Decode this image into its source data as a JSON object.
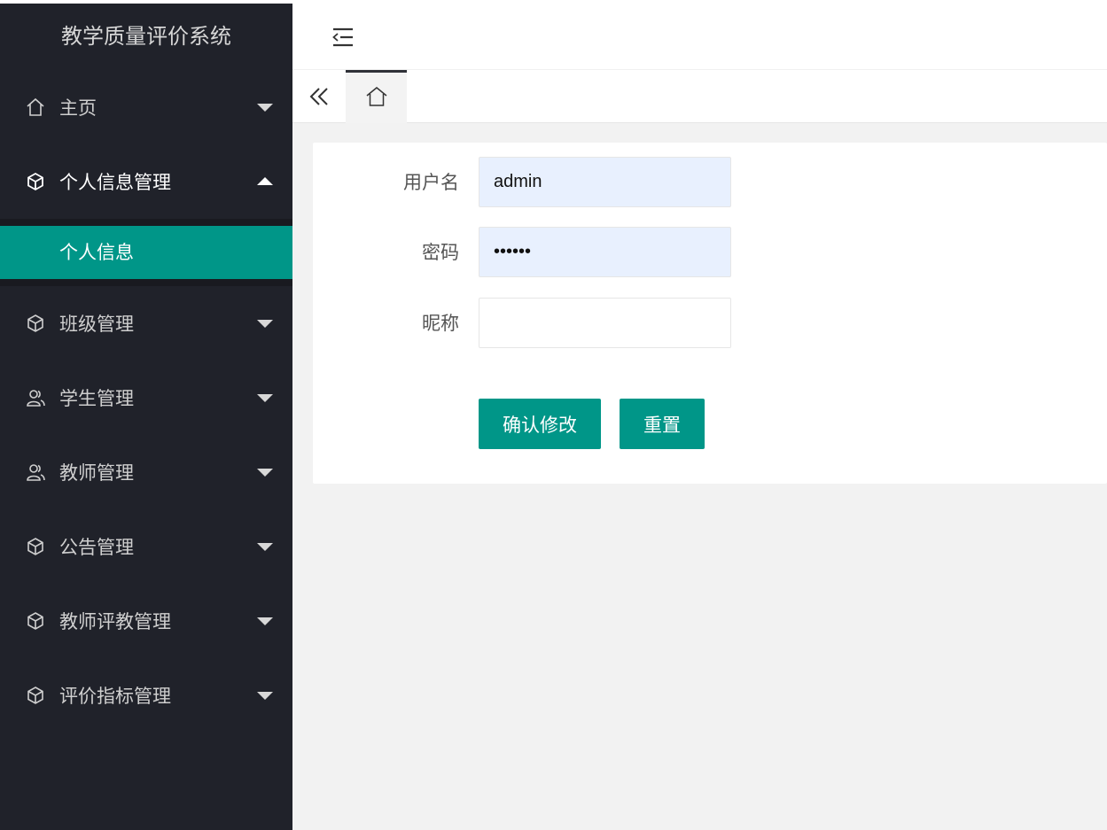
{
  "app": {
    "title": "教学质量评价系统"
  },
  "sidebar": {
    "items": [
      {
        "label": "主页",
        "icon": "home-icon",
        "state": "collapsed"
      },
      {
        "label": "个人信息管理",
        "icon": "cube-icon",
        "state": "expanded",
        "children": [
          {
            "label": "个人信息",
            "active": true
          }
        ]
      },
      {
        "label": "班级管理",
        "icon": "cube-icon",
        "state": "collapsed"
      },
      {
        "label": "学生管理",
        "icon": "users-icon",
        "state": "collapsed"
      },
      {
        "label": "教师管理",
        "icon": "users-icon",
        "state": "collapsed"
      },
      {
        "label": "公告管理",
        "icon": "cube-icon",
        "state": "collapsed"
      },
      {
        "label": "教师评教管理",
        "icon": "cube-icon",
        "state": "collapsed"
      },
      {
        "label": "评价指标管理",
        "icon": "cube-icon",
        "state": "collapsed"
      }
    ]
  },
  "header": {
    "menu_toggle_icon": "shrink-menu-icon"
  },
  "tabs": {
    "scroll_left_icon": "double-chevron-left-icon",
    "home_tab_icon": "home-icon"
  },
  "form": {
    "username": {
      "label": "用户名",
      "value": "admin"
    },
    "password": {
      "label": "密码",
      "value": "••••••"
    },
    "nickname": {
      "label": "昵称",
      "value": ""
    },
    "confirm_label": "确认修改",
    "reset_label": "重置"
  },
  "colors": {
    "sidebar_bg": "#20222a",
    "accent": "#009688",
    "content_bg": "#f2f2f2",
    "autofill_bg": "#e8f0fe"
  }
}
